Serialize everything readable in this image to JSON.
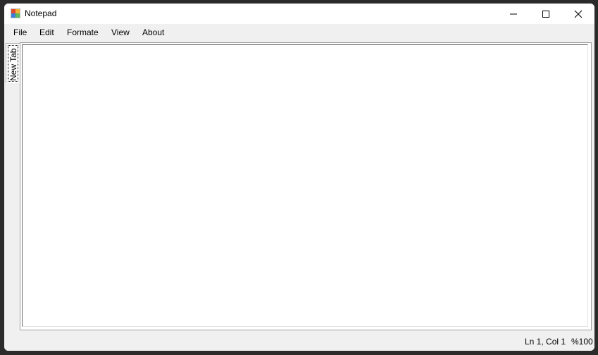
{
  "window": {
    "title": "Notepad",
    "controls": {
      "minimize": "minimize-icon",
      "maximize": "maximize-icon",
      "close": "close-icon"
    }
  },
  "menu": {
    "items": [
      {
        "label": "File"
      },
      {
        "label": "Edit"
      },
      {
        "label": "Formate"
      },
      {
        "label": "View"
      },
      {
        "label": "About"
      }
    ]
  },
  "tabs": [
    {
      "label": "New Tab",
      "selected": true
    }
  ],
  "editor": {
    "value": ""
  },
  "status": {
    "position": "Ln 1, Col 1",
    "zoom": "%100"
  },
  "colors": {
    "chrome": "#f0f0f0",
    "titlebar": "#ffffff",
    "backdrop": "#2b2b2b"
  }
}
